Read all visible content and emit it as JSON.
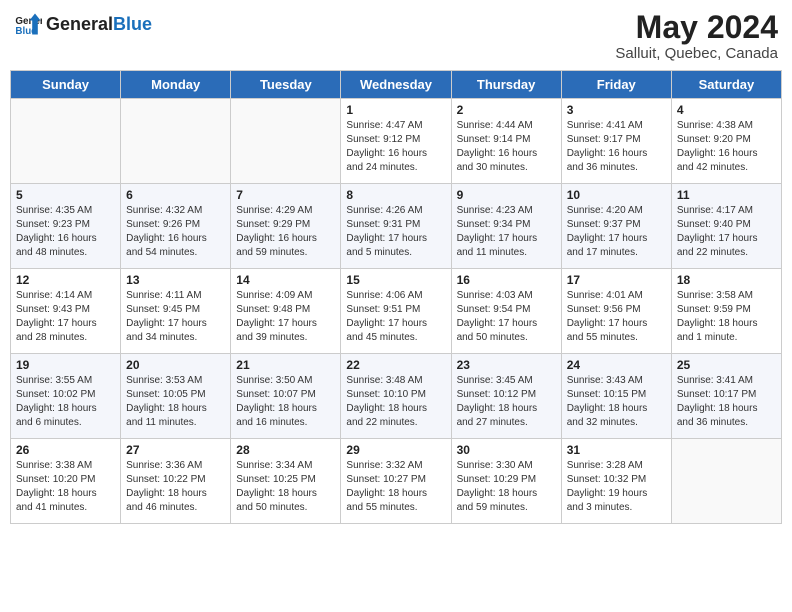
{
  "header": {
    "logo_general": "General",
    "logo_blue": "Blue",
    "month": "May 2024",
    "location": "Salluit, Quebec, Canada"
  },
  "weekdays": [
    "Sunday",
    "Monday",
    "Tuesday",
    "Wednesday",
    "Thursday",
    "Friday",
    "Saturday"
  ],
  "weeks": [
    [
      {
        "day": "",
        "info": ""
      },
      {
        "day": "",
        "info": ""
      },
      {
        "day": "",
        "info": ""
      },
      {
        "day": "1",
        "info": "Sunrise: 4:47 AM\nSunset: 9:12 PM\nDaylight: 16 hours\nand 24 minutes."
      },
      {
        "day": "2",
        "info": "Sunrise: 4:44 AM\nSunset: 9:14 PM\nDaylight: 16 hours\nand 30 minutes."
      },
      {
        "day": "3",
        "info": "Sunrise: 4:41 AM\nSunset: 9:17 PM\nDaylight: 16 hours\nand 36 minutes."
      },
      {
        "day": "4",
        "info": "Sunrise: 4:38 AM\nSunset: 9:20 PM\nDaylight: 16 hours\nand 42 minutes."
      }
    ],
    [
      {
        "day": "5",
        "info": "Sunrise: 4:35 AM\nSunset: 9:23 PM\nDaylight: 16 hours\nand 48 minutes."
      },
      {
        "day": "6",
        "info": "Sunrise: 4:32 AM\nSunset: 9:26 PM\nDaylight: 16 hours\nand 54 minutes."
      },
      {
        "day": "7",
        "info": "Sunrise: 4:29 AM\nSunset: 9:29 PM\nDaylight: 16 hours\nand 59 minutes."
      },
      {
        "day": "8",
        "info": "Sunrise: 4:26 AM\nSunset: 9:31 PM\nDaylight: 17 hours\nand 5 minutes."
      },
      {
        "day": "9",
        "info": "Sunrise: 4:23 AM\nSunset: 9:34 PM\nDaylight: 17 hours\nand 11 minutes."
      },
      {
        "day": "10",
        "info": "Sunrise: 4:20 AM\nSunset: 9:37 PM\nDaylight: 17 hours\nand 17 minutes."
      },
      {
        "day": "11",
        "info": "Sunrise: 4:17 AM\nSunset: 9:40 PM\nDaylight: 17 hours\nand 22 minutes."
      }
    ],
    [
      {
        "day": "12",
        "info": "Sunrise: 4:14 AM\nSunset: 9:43 PM\nDaylight: 17 hours\nand 28 minutes."
      },
      {
        "day": "13",
        "info": "Sunrise: 4:11 AM\nSunset: 9:45 PM\nDaylight: 17 hours\nand 34 minutes."
      },
      {
        "day": "14",
        "info": "Sunrise: 4:09 AM\nSunset: 9:48 PM\nDaylight: 17 hours\nand 39 minutes."
      },
      {
        "day": "15",
        "info": "Sunrise: 4:06 AM\nSunset: 9:51 PM\nDaylight: 17 hours\nand 45 minutes."
      },
      {
        "day": "16",
        "info": "Sunrise: 4:03 AM\nSunset: 9:54 PM\nDaylight: 17 hours\nand 50 minutes."
      },
      {
        "day": "17",
        "info": "Sunrise: 4:01 AM\nSunset: 9:56 PM\nDaylight: 17 hours\nand 55 minutes."
      },
      {
        "day": "18",
        "info": "Sunrise: 3:58 AM\nSunset: 9:59 PM\nDaylight: 18 hours\nand 1 minute."
      }
    ],
    [
      {
        "day": "19",
        "info": "Sunrise: 3:55 AM\nSunset: 10:02 PM\nDaylight: 18 hours\nand 6 minutes."
      },
      {
        "day": "20",
        "info": "Sunrise: 3:53 AM\nSunset: 10:05 PM\nDaylight: 18 hours\nand 11 minutes."
      },
      {
        "day": "21",
        "info": "Sunrise: 3:50 AM\nSunset: 10:07 PM\nDaylight: 18 hours\nand 16 minutes."
      },
      {
        "day": "22",
        "info": "Sunrise: 3:48 AM\nSunset: 10:10 PM\nDaylight: 18 hours\nand 22 minutes."
      },
      {
        "day": "23",
        "info": "Sunrise: 3:45 AM\nSunset: 10:12 PM\nDaylight: 18 hours\nand 27 minutes."
      },
      {
        "day": "24",
        "info": "Sunrise: 3:43 AM\nSunset: 10:15 PM\nDaylight: 18 hours\nand 32 minutes."
      },
      {
        "day": "25",
        "info": "Sunrise: 3:41 AM\nSunset: 10:17 PM\nDaylight: 18 hours\nand 36 minutes."
      }
    ],
    [
      {
        "day": "26",
        "info": "Sunrise: 3:38 AM\nSunset: 10:20 PM\nDaylight: 18 hours\nand 41 minutes."
      },
      {
        "day": "27",
        "info": "Sunrise: 3:36 AM\nSunset: 10:22 PM\nDaylight: 18 hours\nand 46 minutes."
      },
      {
        "day": "28",
        "info": "Sunrise: 3:34 AM\nSunset: 10:25 PM\nDaylight: 18 hours\nand 50 minutes."
      },
      {
        "day": "29",
        "info": "Sunrise: 3:32 AM\nSunset: 10:27 PM\nDaylight: 18 hours\nand 55 minutes."
      },
      {
        "day": "30",
        "info": "Sunrise: 3:30 AM\nSunset: 10:29 PM\nDaylight: 18 hours\nand 59 minutes."
      },
      {
        "day": "31",
        "info": "Sunrise: 3:28 AM\nSunset: 10:32 PM\nDaylight: 19 hours\nand 3 minutes."
      },
      {
        "day": "",
        "info": ""
      }
    ]
  ]
}
